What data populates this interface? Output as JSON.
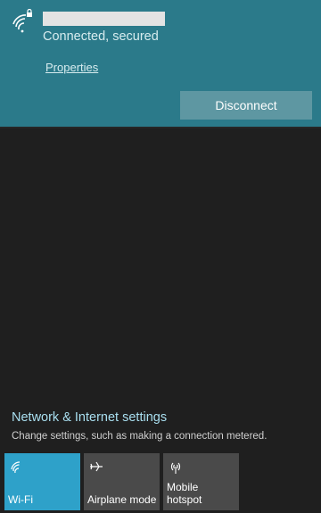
{
  "network": {
    "status": "Connected, secured",
    "properties_label": "Properties",
    "disconnect_label": "Disconnect",
    "icon": "wifi-lock-icon"
  },
  "settings": {
    "title": "Network & Internet settings",
    "description": "Change settings, such as making a connection metered."
  },
  "tiles": [
    {
      "label": "Wi-Fi",
      "icon": "wifi-icon",
      "active": true
    },
    {
      "label": "Airplane mode",
      "icon": "airplane-icon",
      "active": false
    },
    {
      "label": "Mobile\nhotspot",
      "icon": "hotspot-icon",
      "active": false
    }
  ],
  "colors": {
    "card_bg": "#2b7a8a",
    "panel_bg": "#1f1f1f",
    "active_tile": "#2ea1c9",
    "inactive_tile": "#4a4a4a",
    "link": "#a9dff0"
  }
}
